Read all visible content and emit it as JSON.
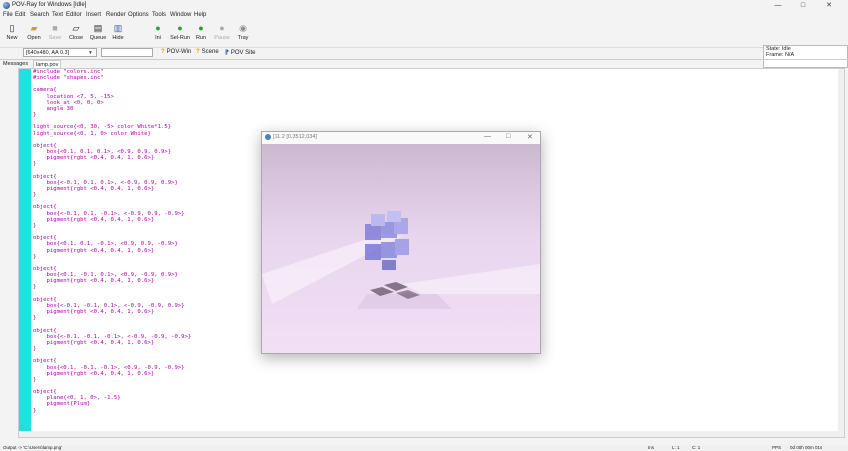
{
  "window": {
    "title": "POV-Ray for Windows [Idle]",
    "minimize": "—",
    "maximize": "□",
    "close": "✕"
  },
  "menu": [
    "File",
    "Edit",
    "Search",
    "Text",
    "Editor",
    "Insert",
    "Render",
    "Options",
    "Tools",
    "Window",
    "Help"
  ],
  "toolbar": [
    {
      "label": "New",
      "icon": "new-icon",
      "glyph": "▯",
      "disabled": false
    },
    {
      "label": "Open",
      "icon": "open-icon",
      "glyph": "▰",
      "disabled": false
    },
    {
      "label": "Save",
      "icon": "save-icon",
      "glyph": "■",
      "disabled": true
    },
    {
      "label": "Close",
      "icon": "close-file-icon",
      "glyph": "▱",
      "disabled": false
    },
    {
      "label": "Queue",
      "icon": "queue-icon",
      "glyph": "▤",
      "disabled": false
    },
    {
      "label": "Hide",
      "icon": "hide-icon",
      "glyph": "▥",
      "disabled": false
    },
    {
      "label": "Ini",
      "icon": "ini-icon",
      "glyph": "●",
      "disabled": false
    },
    {
      "label": "Sel-Run",
      "icon": "sel-run-icon",
      "glyph": "●",
      "disabled": false
    },
    {
      "label": "Run",
      "icon": "run-icon",
      "glyph": "●",
      "disabled": false
    },
    {
      "label": "Pause",
      "icon": "pause-icon",
      "glyph": "●",
      "disabled": true
    },
    {
      "label": "Tray",
      "icon": "tray-icon",
      "glyph": "◉",
      "disabled": false
    }
  ],
  "status": {
    "state": "State:  Idle",
    "frame": "Frame:  N/A"
  },
  "toolbar2": {
    "resolution": "[640x480, AA 0.3]",
    "links": [
      "POV-Win",
      "Scene",
      "POV Site"
    ]
  },
  "tabs": [
    "Messages",
    "lamp.pov"
  ],
  "code": "#include \"colors.inc\"\n#include \"shapes.inc\"\n\ncamera{\n    location <7, 5, -15>\n    look_at <0, 0, 0>\n    angle 30\n}\n\nlight_source{<0, 30, -5> color White*1.5}\nlight_source{<0, 1, 0> color White}\n\nobject{\n    box{<0.1, 0.1, 0.1>, <0.9, 0.9, 0.9>}\n    pigment{rgbt <0.4, 0.4, 1, 0.6>}\n}\n\nobject{\n    box{<-0.1, 0.1, 0.1>, <-0.9, 0.9, 0.9>}\n    pigment{rgbt <0.4, 0.4, 1, 0.6>}\n}\n\nobject{\n    box{<-0.1, 0.1, -0.1>, <-0.9, 0.9, -0.9>}\n    pigment{rgbt <0.4, 0.4, 1, 0.6>}\n}\n\nobject{\n    box{<0.1, 0.1, -0.1>, <0.9, 0.9, -0.9>}\n    pigment{rgbt <0.4, 0.4, 1, 0.6>}\n}\n\nobject{\n    box{<0.1, -0.1, 0.1>, <0.9, -0.9, 0.9>}\n    pigment{rgbt <0.4, 0.4, 1, 0.6>}\n}\n\nobject{\n    box{<-0.1, -0.1, 0.1>, <-0.9, -0.9, 0.9>}\n    pigment{rgbt <0.4, 0.4, 1, 0.6>}\n}\n\nobject{\n    box{<-0.1, -0.1, -0.1>, <-0.9, -0.9, -0.9>}\n    pigment{rgbt <0.4, 0.4, 1, 0.6>}\n}\n\nobject{\n    box{<0.1, -0.1, -0.1>, <0.9, -0.9, -0.9>}\n    pigment{rgbt <0.4, 0.4, 1, 0.6>}\n}\n\nobject{\n    plane{<0, 1, 0>, -1.5}\n    pigment{Plum}\n}",
  "render_window": {
    "title": "[11.2 [0.3512.034]",
    "minimize": "—",
    "maximize": "□",
    "close": "✕"
  },
  "bottom": {
    "output": "Output -> 'C:\\Users\\lamp.png'",
    "mode": "Ins",
    "line": "L: 1",
    "col": "C: 1",
    "pps": "PPS",
    "time": "0d 00h 00m 01s"
  },
  "colors": {
    "gutter": "#20e0e0",
    "code": "#b000b0",
    "plane": "#ead6f2",
    "box": "#8f8ee6"
  }
}
